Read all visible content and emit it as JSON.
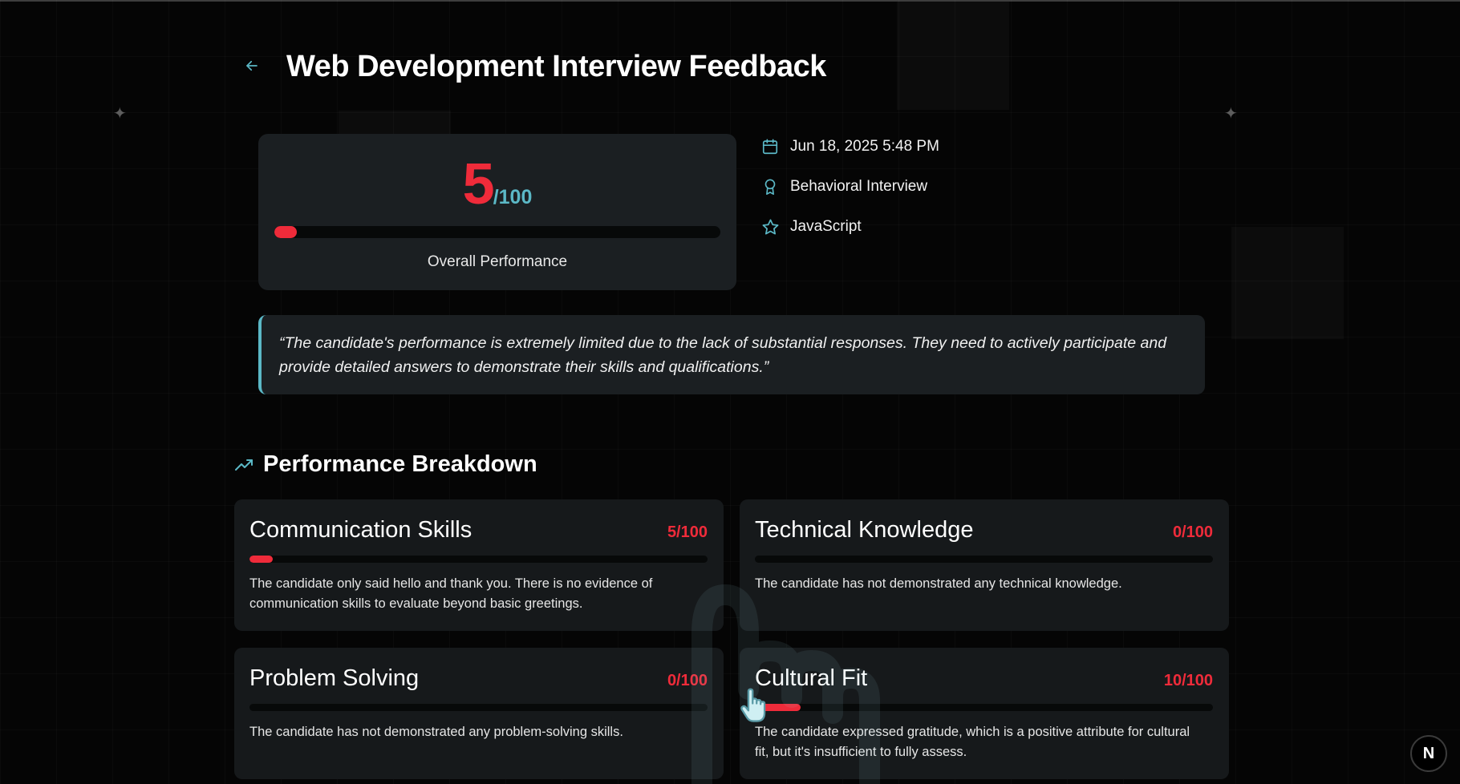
{
  "header": {
    "back_icon": "arrow-left-icon",
    "title": "Web Development Interview Feedback"
  },
  "overall": {
    "score": "5",
    "denominator": "/100",
    "progress_percent": 5,
    "label": "Overall Performance",
    "accent_color": "#ef2b3a",
    "secondary_color": "#5bb8c6"
  },
  "meta": {
    "date": {
      "icon": "calendar-icon",
      "text": "Jun 18, 2025 5:48 PM"
    },
    "type": {
      "icon": "award-icon",
      "text": "Behavioral Interview"
    },
    "tech": {
      "icon": "star-icon",
      "text": "JavaScript"
    }
  },
  "summary_quote": "“The candidate's performance is extremely limited due to the lack of substantial responses. They need to actively participate and provide detailed answers to demonstrate their skills and qualifications.”",
  "breakdown": {
    "icon": "trending-up-icon",
    "title": "Performance Breakdown",
    "categories": [
      {
        "name": "Communication Skills",
        "score": "5/100",
        "progress_percent": 5,
        "comment": "The candidate only said hello and thank you. There is no evidence of communication skills to evaluate beyond basic greetings."
      },
      {
        "name": "Technical Knowledge",
        "score": "0/100",
        "progress_percent": 0,
        "comment": "The candidate has not demonstrated any technical knowledge."
      },
      {
        "name": "Problem Solving",
        "score": "0/100",
        "progress_percent": 0,
        "comment": "The candidate has not demonstrated any problem-solving skills."
      },
      {
        "name": "Cultural Fit",
        "score": "10/100",
        "progress_percent": 10,
        "comment": "The candidate expressed gratitude, which is a positive attribute for cultural fit, but it's insufficient to fully assess."
      }
    ]
  },
  "dev_badge": {
    "icon": "nextjs-logo-icon",
    "letter": "N"
  }
}
